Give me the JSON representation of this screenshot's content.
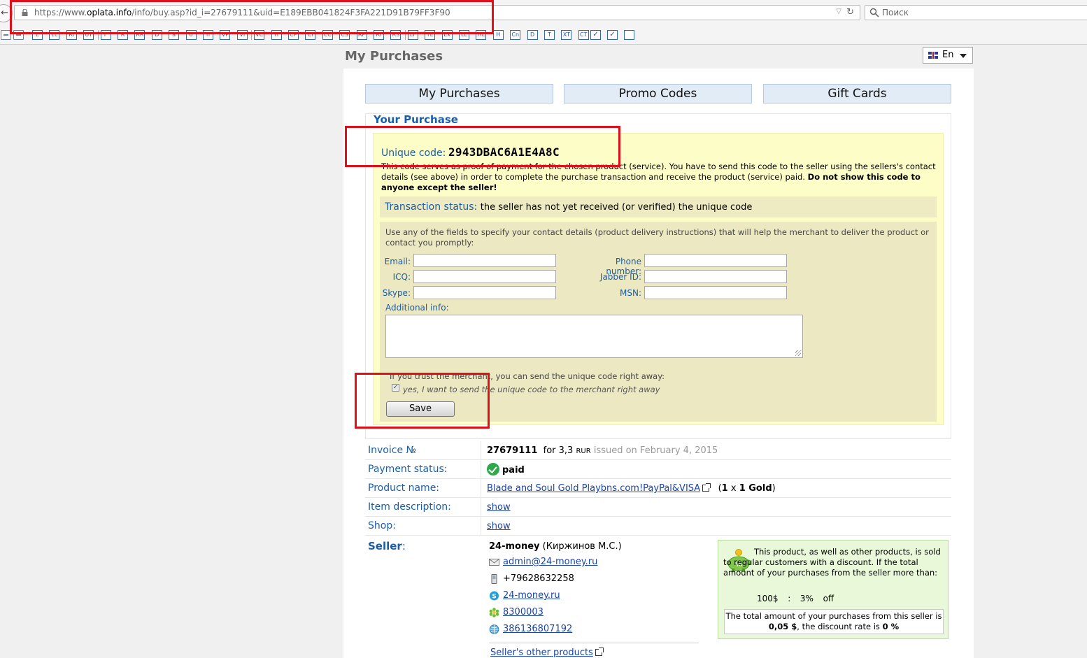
{
  "browser": {
    "url_prefix": "https://www.",
    "url_domain": "oplata.info",
    "url_rest": "/info/buy.asp?id_i=27679111&uid=E189EBB041824F3FA221D91B79FF3F90",
    "search_placeholder": "Поиск",
    "toolbar_buttons": [
      "E",
      "Ec",
      "RI",
      "UT",
      "F",
      "R",
      "RR",
      "D",
      "a",
      "o",
      "n",
      "VP",
      "VI",
      "VC",
      "H",
      "CP",
      "CI",
      "CC",
      "CS",
      "RP",
      "RI",
      "RS",
      "LF",
      "TE",
      "Ex",
      "LL",
      "HL",
      "H",
      "Cn",
      "D",
      "T",
      "XT",
      "CT"
    ]
  },
  "page": {
    "title": "My Purchases",
    "language": "En"
  },
  "tabs": [
    "My Purchases",
    "Promo Codes",
    "Gift Cards"
  ],
  "purchase": {
    "legend": "Your Purchase",
    "code_label": "Unique code:",
    "code_value": "2943DBAC6A1E4A8C",
    "code_desc": "This code serves as proof of payment for the chosen product (service). You have to send this code to the seller using the sellers's contact details (see above) in order to complete the purchase transaction and receive the product (service) paid.",
    "code_desc_bold": "Do not show this code to anyone except the seller!",
    "status_label": "Transaction status:",
    "status_text": "the seller has not yet received (or verified) the unique code",
    "contact_intro": "Use any of the fields to specify your contact details (product delivery instructions) that will help the merchant to deliver the product or contact you promptly:",
    "fields": {
      "email": "Email:",
      "phone": "Phone number:",
      "icq": "ICQ:",
      "jabber": "Jabber ID:",
      "skype": "Skype:",
      "msn": "MSN:",
      "additional": "Additional info:"
    },
    "trust_text": "If you trust the merchant, you can send the unique code right away:",
    "trust_label": "yes, I want to send the unique code to the merchant right away",
    "save_label": "Save"
  },
  "details": {
    "invoice_label": "Invoice №",
    "invoice_number": "27679111",
    "invoice_for": "for 3,3",
    "invoice_currency": "RUR",
    "invoice_issued": "issued on February 4, 2015",
    "payment_label": "Payment status:",
    "payment_value": "paid",
    "product_label": "Product name:",
    "product_name": "Blade and Soul Gold Playbns.com!PayPal&VISA",
    "product_qty_open": "(",
    "product_qty": "1",
    "product_qty_x": "x",
    "product_qty_unit": "1 Gold",
    "product_qty_close": ")",
    "item_label": "Item description:",
    "item_link": "show",
    "shop_label": "Shop:",
    "shop_link": "show"
  },
  "seller": {
    "label": "Seller",
    "label_suffix": ":",
    "name": "24-money",
    "owner": "(Киржинов М.С.)",
    "email": "admin@24-money.ru",
    "phone": "+79628632258",
    "skype": "24-money.ru",
    "icq": "8300003",
    "jabber": "386136807192",
    "other_products": "Seller's other products"
  },
  "discount": {
    "text": "This product, as well as other products, is sold to regular customers with a discount. If the total amount of your purchases from the seller more than:",
    "threshold": "100$",
    "colon": ":",
    "percent": "3%",
    "off": "off",
    "total_prefix": "The total amount of your purchases from this seller is",
    "total_amount": "0,05 $",
    "total_mid": ", the discount rate is",
    "total_rate": "0 %"
  },
  "colors": {
    "accent": "#1a5ea8",
    "annotation": "#e0101a",
    "code_bg": "#fdfdc8",
    "discount_bg": "#e9f8d9"
  }
}
